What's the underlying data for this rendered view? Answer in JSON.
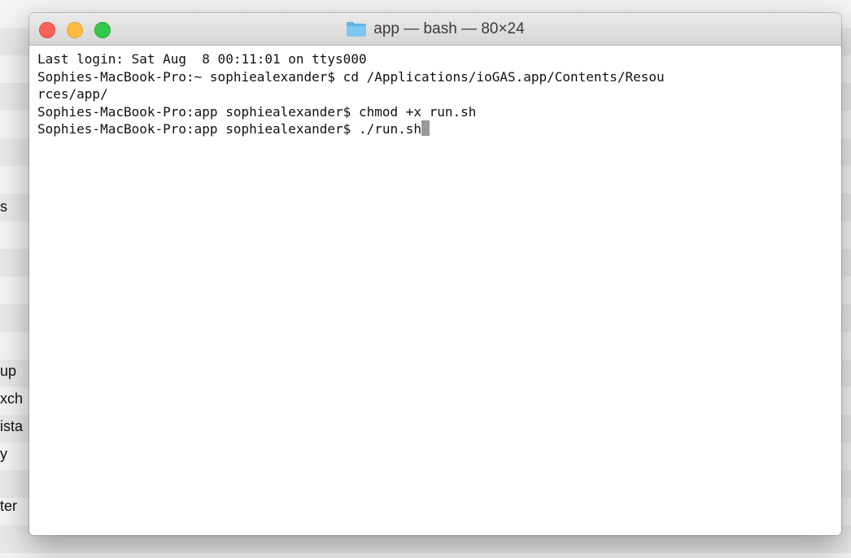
{
  "window": {
    "title": "app — bash — 80×24",
    "title_icon": "folder-icon"
  },
  "terminal": {
    "lines": [
      "Last login: Sat Aug  8 00:11:01 on ttys000",
      "Sophies-MacBook-Pro:~ sophiealexander$ cd /Applications/ioGAS.app/Contents/Resou",
      "rces/app/",
      "Sophies-MacBook-Pro:app sophiealexander$ chmod +x run.sh",
      "Sophies-MacBook-Pro:app sophiealexander$ ./run.sh"
    ]
  },
  "background_window": {
    "sidebar_fragments": [
      "s",
      "up",
      "xch",
      "ista",
      "y",
      "ter"
    ]
  },
  "colors": {
    "close": "#fc605b",
    "minimize": "#fdbc40",
    "maximize": "#34c84a",
    "cursor": "#9a9a9a"
  }
}
